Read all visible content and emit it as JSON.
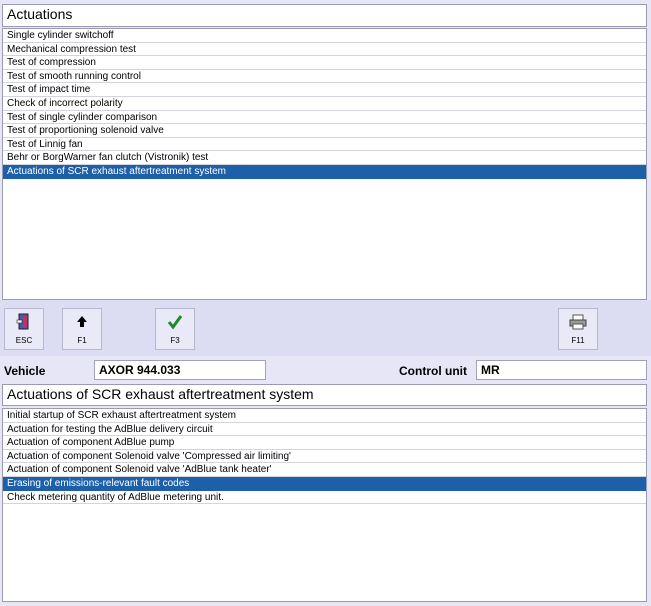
{
  "top": {
    "title": "Actuations",
    "items": [
      "Single cylinder switchoff",
      "Mechanical compression test",
      "Test of compression",
      "Test of smooth running control",
      "Test of impact time",
      "Check of incorrect polarity",
      "Test of single cylinder comparison",
      "Test of proportioning solenoid valve",
      "Test of Linnig fan",
      "Behr or BorgWarner fan clutch (Vistronik) test",
      "Actuations of SCR exhaust aftertreatment system"
    ],
    "selected_index": 10
  },
  "toolbar": {
    "buttons": [
      {
        "label": "ESC",
        "icon": "exit-door-icon"
      },
      {
        "label": "F1",
        "icon": "arrow-up-icon"
      },
      {
        "label": "F3",
        "icon": "checkmark-icon"
      },
      {
        "label": "F11",
        "icon": "printer-icon"
      }
    ]
  },
  "vehicle": {
    "label": "Vehicle",
    "value": "AXOR 944.033"
  },
  "control_unit": {
    "label": "Control unit",
    "value": "MR"
  },
  "bottom": {
    "title": "Actuations of SCR exhaust aftertreatment system",
    "items": [
      "Initial startup of SCR exhaust aftertreatment system",
      "Actuation for testing the AdBlue delivery circuit",
      "Actuation of component AdBlue pump",
      "Actuation of component Solenoid valve 'Compressed air limiting'",
      "Actuation of component Solenoid valve 'AdBlue tank heater'",
      "Erasing of emissions-relevant fault codes",
      "Check metering quantity of AdBlue metering unit."
    ],
    "selected_index": 5
  },
  "colors": {
    "selection": "#1d5fa8",
    "background": "#e6e6f6"
  }
}
